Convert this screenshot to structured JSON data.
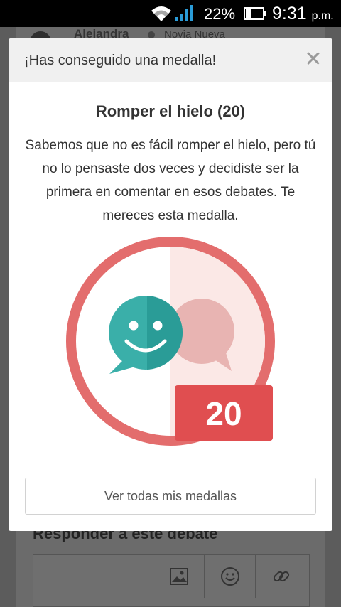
{
  "status_bar": {
    "battery_percent": "22%",
    "time": "9:31",
    "ampm": "p.m."
  },
  "background": {
    "username": "Alejandra",
    "user_role": "Novia Nueva",
    "reply_title": "Responder a este debate",
    "toolbar_icons": [
      "image-icon",
      "emoji-icon",
      "link-icon"
    ]
  },
  "modal": {
    "header_title": "¡Has conseguido una medalla!",
    "close_label": "✕",
    "medal_name": "Romper el hielo (20)",
    "medal_description": "Sabemos que no es fácil romper el hielo, pero tú no lo pensaste dos veces y decidiste ser la primera en comentar en esos debates. Te mereces esta medalla.",
    "medal_count": "20",
    "all_medals_button": "Ver todas mis medallas"
  },
  "colors": {
    "medal_ring": "#e36d6d",
    "medal_badge": "#e04e50",
    "bubble_teal": "#3aafa9",
    "bubble_teal_dark": "#2a9c97",
    "bubble_pink": "#e8b4b2"
  }
}
